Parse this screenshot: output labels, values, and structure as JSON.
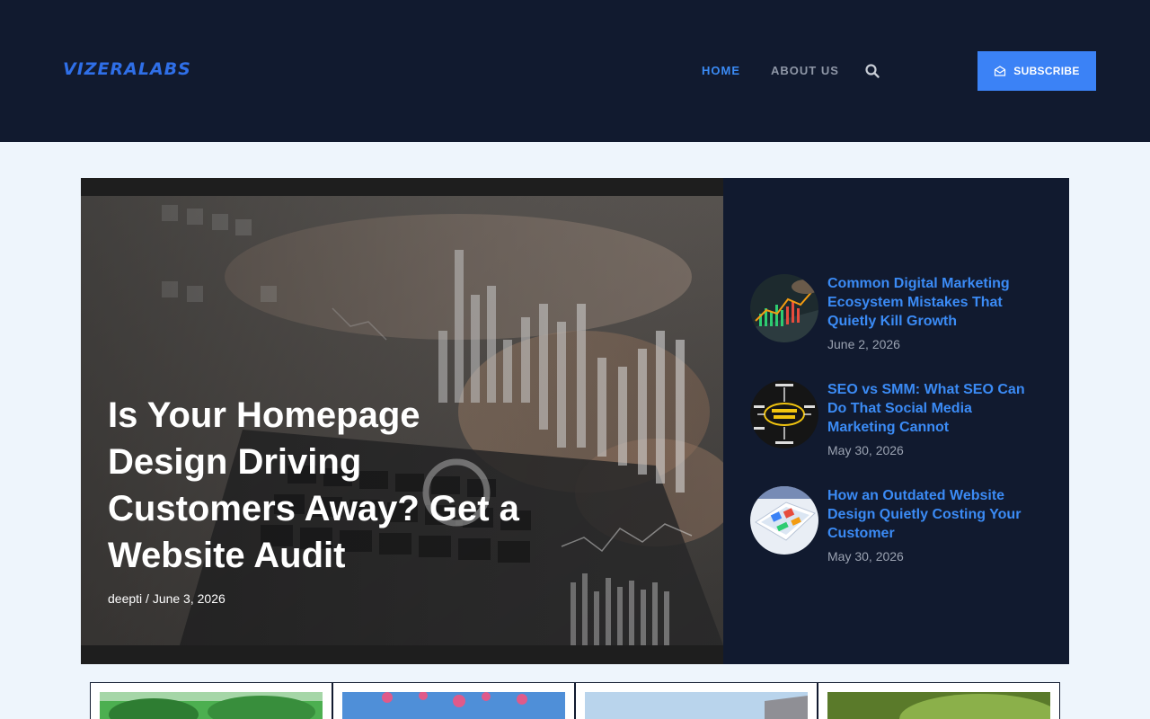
{
  "brand": {
    "logo_text": "VIZERALABS"
  },
  "nav": {
    "home": "HOME",
    "about": "ABOUT US",
    "subscribe": "SUBSCRIBE"
  },
  "hero": {
    "title": "Is Your Homepage Design Driving Customers Away? Get a Website Audit",
    "meta": "deepti / June 3, 2026"
  },
  "sidebar_posts": [
    {
      "title": "Common Digital Marketing Ecosystem Mistakes That Quietly Kill Growth",
      "date": "June 2, 2026"
    },
    {
      "title": "SEO vs SMM: What SEO Can Do That Social Media Marketing Cannot",
      "date": "May 30, 2026"
    },
    {
      "title": "How an Outdated Website Design Quietly Costing Your Customer",
      "date": "May 30, 2026"
    }
  ],
  "colors": {
    "header_bg": "#111a2f",
    "accent": "#3b82f6",
    "page_bg": "#eef5fc"
  },
  "icons": [
    "search-icon",
    "envelope-icon"
  ]
}
